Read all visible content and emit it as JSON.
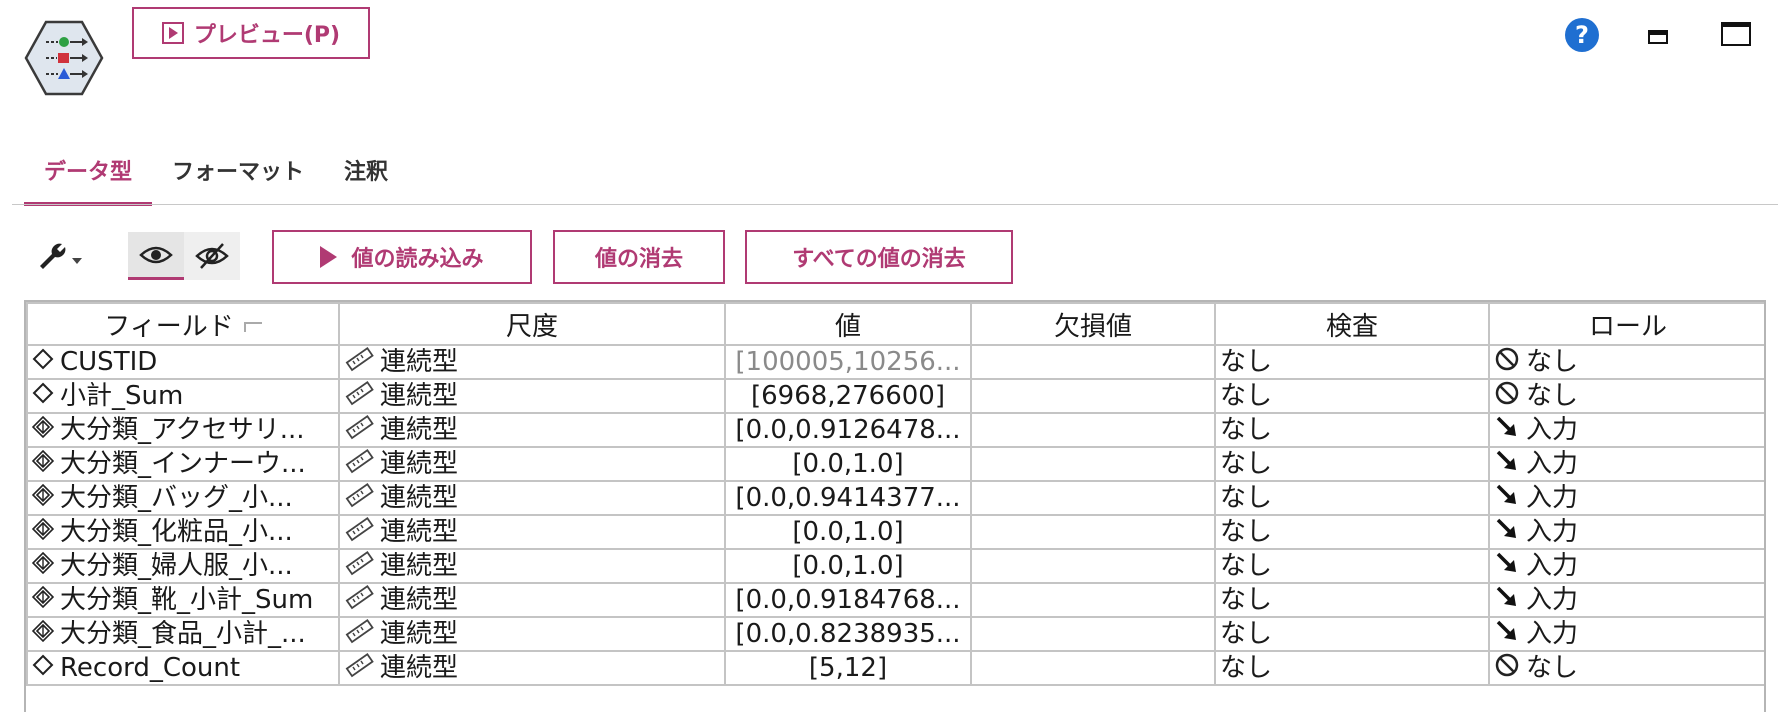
{
  "toolbar_top": {
    "preview_label": "プレビュー(P)"
  },
  "tabs": [
    {
      "label": "データ型",
      "active": true
    },
    {
      "label": "フォーマット",
      "active": false
    },
    {
      "label": "注釈",
      "active": false
    }
  ],
  "actions": {
    "read_values": "値の読み込み",
    "clear_values": "値の消去",
    "clear_all_values": "すべての値の消去"
  },
  "table": {
    "headers": [
      "フィールド",
      "尺度",
      "値",
      "欠損値",
      "検査",
      "ロール"
    ],
    "rows": [
      {
        "field": "CUSTID",
        "field_icon": "typeless-diamond-icon",
        "measure": "連続型",
        "value": "[100005,10256...",
        "value_dim": true,
        "missing": "",
        "check": "なし",
        "role": "なし",
        "role_icon": "none-role-icon"
      },
      {
        "field": "小計_Sum",
        "field_icon": "typeless-diamond-icon",
        "measure": "連続型",
        "value": "[6968,276600]",
        "value_dim": false,
        "missing": "",
        "check": "なし",
        "role": "なし",
        "role_icon": "none-role-icon"
      },
      {
        "field": "大分類_アクセサリ...",
        "field_icon": "derived-field-icon",
        "measure": "連続型",
        "value": "[0.0,0.9126478...",
        "value_dim": false,
        "missing": "",
        "check": "なし",
        "role": "入力",
        "role_icon": "input-role-icon"
      },
      {
        "field": "大分類_インナーウ...",
        "field_icon": "derived-field-icon",
        "measure": "連続型",
        "value": "[0.0,1.0]",
        "value_dim": false,
        "missing": "",
        "check": "なし",
        "role": "入力",
        "role_icon": "input-role-icon"
      },
      {
        "field": "大分類_バッグ_小...",
        "field_icon": "derived-field-icon",
        "measure": "連続型",
        "value": "[0.0,0.9414377...",
        "value_dim": false,
        "missing": "",
        "check": "なし",
        "role": "入力",
        "role_icon": "input-role-icon"
      },
      {
        "field": "大分類_化粧品_小...",
        "field_icon": "derived-field-icon",
        "measure": "連続型",
        "value": "[0.0,1.0]",
        "value_dim": false,
        "missing": "",
        "check": "なし",
        "role": "入力",
        "role_icon": "input-role-icon"
      },
      {
        "field": "大分類_婦人服_小...",
        "field_icon": "derived-field-icon",
        "measure": "連続型",
        "value": "[0.0,1.0]",
        "value_dim": false,
        "missing": "",
        "check": "なし",
        "role": "入力",
        "role_icon": "input-role-icon"
      },
      {
        "field": "大分類_靴_小計_Sum",
        "field_icon": "derived-field-icon",
        "measure": "連続型",
        "value": "[0.0,0.9184768...",
        "value_dim": false,
        "missing": "",
        "check": "なし",
        "role": "入力",
        "role_icon": "input-role-icon"
      },
      {
        "field": "大分類_食品_小計_...",
        "field_icon": "derived-field-icon",
        "measure": "連続型",
        "value": "[0.0,0.8238935...",
        "value_dim": false,
        "missing": "",
        "check": "なし",
        "role": "入力",
        "role_icon": "input-role-icon"
      },
      {
        "field": "Record_Count",
        "field_icon": "typeless-diamond-icon",
        "measure": "連続型",
        "value": "[5,12]",
        "value_dim": false,
        "missing": "",
        "check": "なし",
        "role": "なし",
        "role_icon": "none-role-icon"
      }
    ]
  },
  "colors": {
    "accent": "#b03a73",
    "help": "#1f6fd1",
    "node_fill": "#dfe6ee"
  }
}
